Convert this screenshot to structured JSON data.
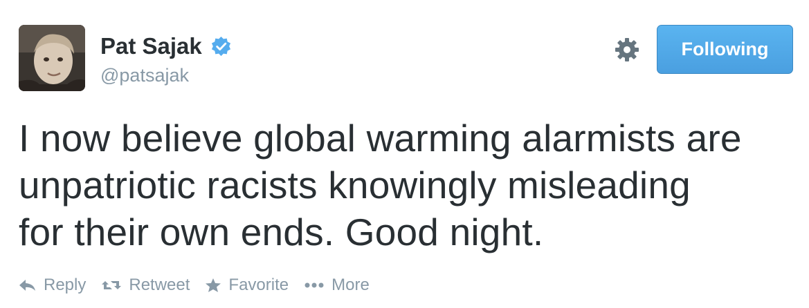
{
  "user": {
    "name": "Pat Sajak",
    "handle": "@patsajak",
    "verified": true
  },
  "follow_button": {
    "label": "Following"
  },
  "tweet": {
    "lines": [
      "I now believe global warming alarmists are",
      "unpatriotic racists knowingly misleading",
      "for their own ends. Good night."
    ]
  },
  "actions": {
    "reply": "Reply",
    "retweet": "Retweet",
    "favorite": "Favorite",
    "more": "More"
  },
  "icons": {
    "verified": "verified-badge-icon",
    "settings": "gear-icon",
    "reply": "reply-arrow-icon",
    "retweet": "retweet-icon",
    "favorite": "star-icon",
    "more": "ellipsis-icon"
  },
  "colors": {
    "accent": "#55acee",
    "text": "#292f33",
    "muted": "#8899a6",
    "verified": "#55acee"
  }
}
